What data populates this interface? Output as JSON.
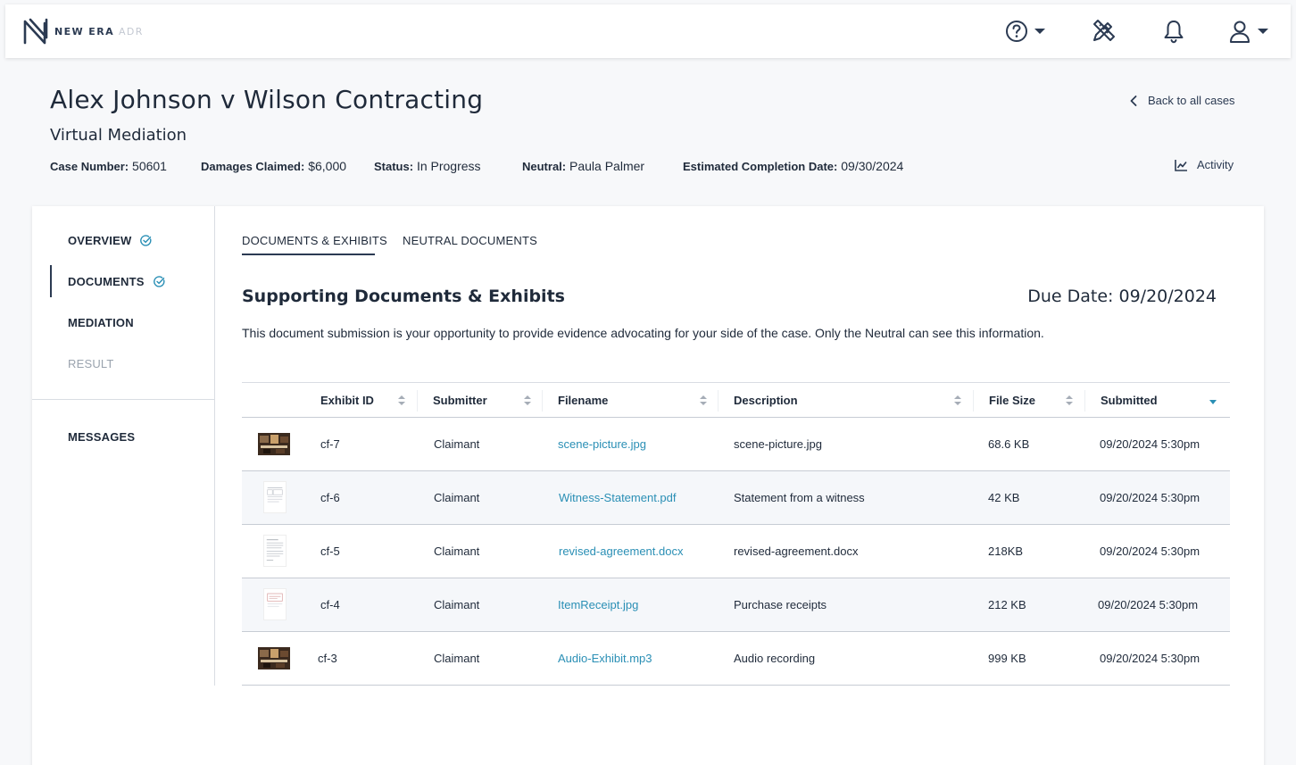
{
  "header": {
    "logo_text": "NEW ERA",
    "logo_sub": "ADR",
    "icons": [
      "help-icon",
      "pen-ruler-icon",
      "bell-icon",
      "user-icon"
    ]
  },
  "case": {
    "title": "Alex Johnson v Wilson Contracting",
    "type": "Virtual Mediation",
    "case_number_label": "Case Number:",
    "case_number": "50601",
    "damages_label": "Damages Claimed:",
    "damages": "$6,000",
    "status_label": "Status:",
    "status": "In Progress",
    "neutral_label": "Neutral:",
    "neutral": "Paula Palmer",
    "completion_label": "Estimated Completion Date:",
    "completion": "09/30/2024",
    "back_label": "Back to all cases",
    "activity_label": "Activity"
  },
  "sidebar": {
    "items": [
      {
        "label": "OVERVIEW",
        "checked": true
      },
      {
        "label": "DOCUMENTS",
        "checked": true
      },
      {
        "label": "MEDIATION",
        "checked": false
      },
      {
        "label": "RESULT",
        "checked": false
      },
      {
        "label": "MESSAGES",
        "checked": false
      }
    ]
  },
  "tabs": [
    {
      "label": "DOCUMENTS & EXHIBITS",
      "active": true
    },
    {
      "label": "NEUTRAL DOCUMENTS",
      "active": false
    }
  ],
  "section": {
    "title": "Supporting Documents & Exhibits",
    "due_date": "Due Date: 09/20/2024",
    "description": "This document submission is your opportunity to provide evidence advocating for your side of the case. Only the Neutral can see this information."
  },
  "table": {
    "headers": [
      "Exhibit ID",
      "Submitter",
      "Filename",
      "Description",
      "File Size",
      "Submitted"
    ],
    "rows": [
      {
        "thumb": "photo",
        "id": "cf-7",
        "submitter": "Claimant",
        "filename": "scene-picture.jpg",
        "description": "scene-picture.jpg",
        "size": "68.6 KB",
        "submitted": "09/20/2024 5:30pm"
      },
      {
        "thumb": "document",
        "id": "cf-6",
        "submitter": "Claimant",
        "filename": "Witness-Statement.pdf",
        "description": "Statement from a witness",
        "size": "42 KB",
        "submitted": "09/20/2024 5:30pm"
      },
      {
        "thumb": "document",
        "id": "cf-5",
        "submitter": "Claimant",
        "filename": "revised-agreement.docx",
        "description": "revised-agreement.docx",
        "size": "218KB",
        "submitted": "09/20/2024 5:30pm"
      },
      {
        "thumb": "document",
        "id": "cf-4",
        "submitter": "Claimant",
        "filename": "ItemReceipt.jpg",
        "description": "Purchase receipts",
        "size": "212 KB",
        "submitted": "09/20/2024 5:30pm"
      },
      {
        "thumb": "photo",
        "id": "cf-3",
        "submitter": "Claimant",
        "filename": "Audio-Exhibit.mp3",
        "description": "Audio recording",
        "size": "999 KB",
        "submitted": "09/20/2024 5:30pm"
      }
    ]
  },
  "colors": {
    "navy": "#2b3a52",
    "link": "#2a8fb5",
    "check": "#2a8fb5",
    "alt_row": "#f5f7fa"
  }
}
